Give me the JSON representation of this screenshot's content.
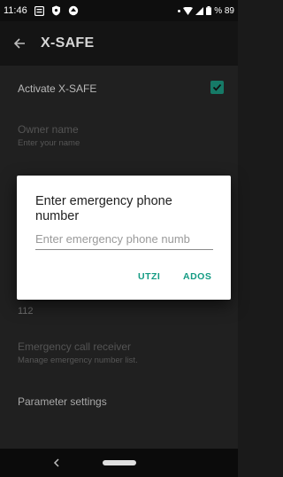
{
  "status_bar": {
    "time": "11:46",
    "battery": "% 89"
  },
  "app_bar": {
    "title": "X-SAFE"
  },
  "settings": {
    "activate": {
      "title": "Activate X-SAFE",
      "checked": true
    },
    "owner_name": {
      "title": "Owner name",
      "summary": "Enter your name"
    },
    "emergency_number_value": "112",
    "emergency_receiver": {
      "title": "Emergency call receiver",
      "summary": "Manage emergency number list."
    },
    "parameter_settings": {
      "title": "Parameter settings"
    }
  },
  "dialog": {
    "title": "Enter emergency phone number",
    "input_placeholder": "Enter emergency phone numb",
    "input_value": "",
    "negative_button": "UTZI",
    "positive_button": "ADOS"
  },
  "colors": {
    "accent": "#139b83",
    "checkbox": "#167a67"
  }
}
